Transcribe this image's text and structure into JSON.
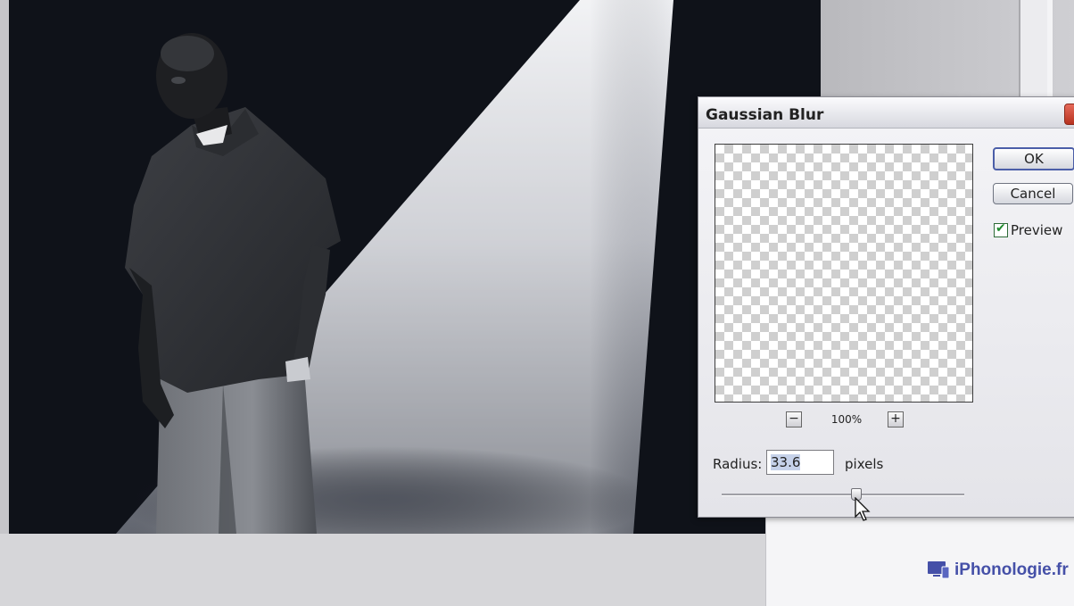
{
  "dialog": {
    "title": "Gaussian Blur",
    "ok_label": "OK",
    "cancel_label": "Cancel",
    "preview_label": "Preview",
    "preview_checked": true,
    "zoom_out_symbol": "−",
    "zoom_level": "100%",
    "zoom_in_symbol": "+",
    "radius_label": "Radius:",
    "radius_value": "33.6",
    "radius_unit": "pixels",
    "slider_level": 0.55
  },
  "watermark": {
    "text": "iPhonologie.fr",
    "icon": "devices-icon",
    "color": "#4550a8"
  },
  "colors": {
    "canvas_bg": "#0f1219",
    "checkbox_mark": "#1f8a2e",
    "ok_border": "#4b5ea8"
  }
}
